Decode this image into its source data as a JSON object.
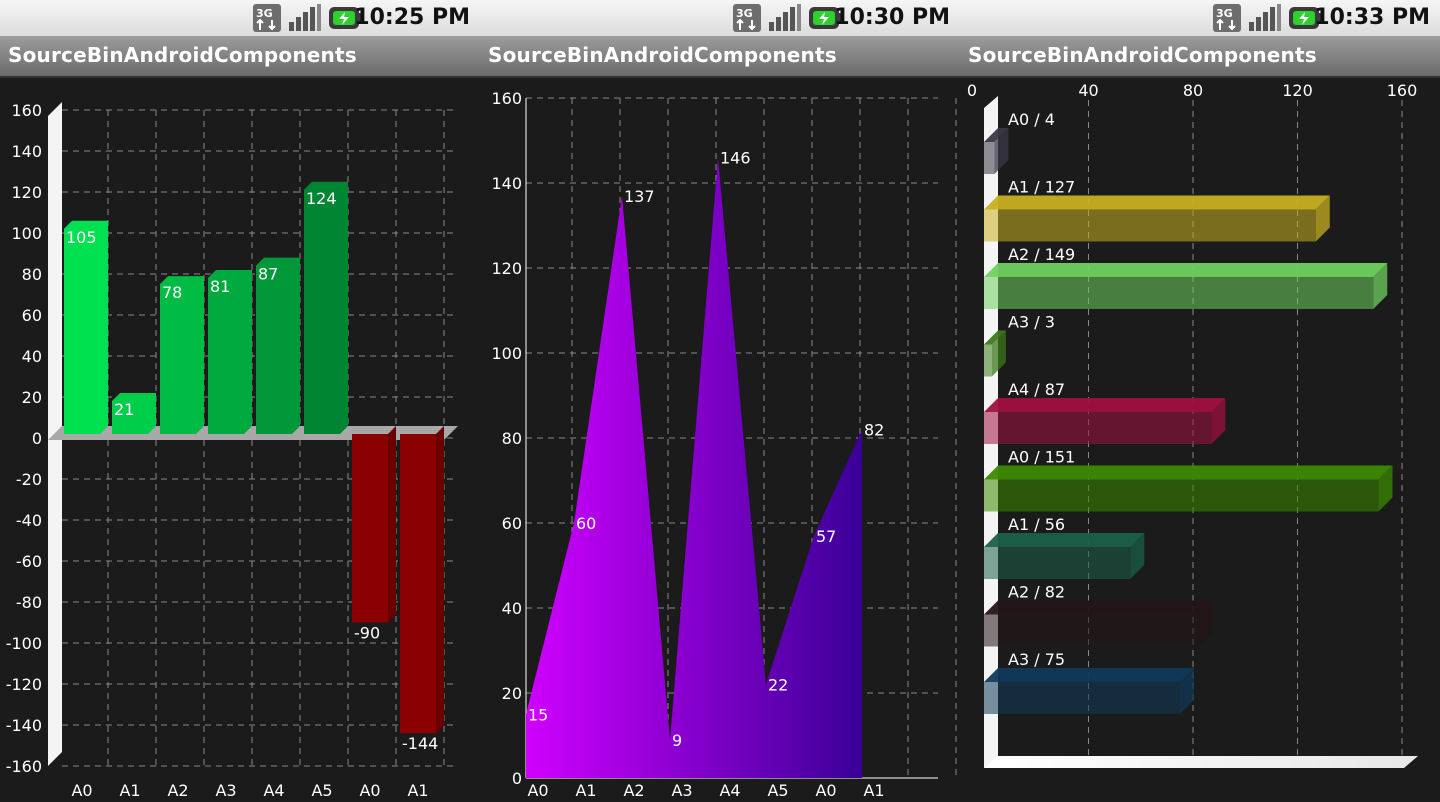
{
  "screens": [
    {
      "time": "10:25 PM",
      "title": "SourceBinAndroidComponents"
    },
    {
      "time": "10:30 PM",
      "title": "SourceBinAndroidComponents"
    },
    {
      "time": "10:33 PM",
      "title": "SourceBinAndroidComponents"
    }
  ],
  "status_icons": [
    "network-3g-icon",
    "signal-strength-icon",
    "battery-charging-icon"
  ],
  "colors": {
    "positive_bar": "#00d050",
    "negative_bar": "#8b0000",
    "area_start": "#d000ff",
    "area_end": "#3a0098"
  },
  "chart_data": [
    {
      "type": "bar",
      "categories": [
        "A0",
        "A1",
        "A2",
        "A3",
        "A4",
        "A5",
        "A0",
        "A1"
      ],
      "values": [
        105,
        21,
        78,
        81,
        87,
        124,
        -90,
        -144
      ],
      "ylim": [
        -160,
        160
      ],
      "yticks": [
        160,
        140,
        120,
        100,
        80,
        60,
        40,
        20,
        0,
        -20,
        -40,
        -60,
        -80,
        -100,
        -120,
        -140,
        -160
      ],
      "grid": true
    },
    {
      "type": "area",
      "categories": [
        "A0",
        "A1",
        "A2",
        "A3",
        "A4",
        "A5",
        "A0",
        "A1"
      ],
      "values": [
        15,
        60,
        137,
        9,
        146,
        22,
        57,
        82
      ],
      "ylim": [
        0,
        160
      ],
      "yticks": [
        0,
        20,
        40,
        60,
        80,
        100,
        120,
        140,
        160
      ],
      "grid": true
    },
    {
      "type": "bar",
      "orientation": "horizontal",
      "categories": [
        "A0",
        "A1",
        "A2",
        "A3",
        "A4",
        "A0",
        "A1",
        "A2",
        "A3"
      ],
      "values": [
        4,
        127,
        149,
        3,
        87,
        151,
        56,
        82,
        75
      ],
      "labels": [
        "A0 / 4",
        "A1 / 127",
        "A2 / 149",
        "A3 / 3",
        "A4 / 87",
        "A0 / 151",
        "A1 / 56",
        "A2 / 82",
        "A3 / 75"
      ],
      "colors": [
        "#3a3848",
        "#c8b020",
        "#70d060",
        "#3c7a1a",
        "#a01040",
        "#3c8a00",
        "#1a6048",
        "#241418",
        "#103a5a"
      ],
      "xlim": [
        0,
        160
      ],
      "xticks": [
        0,
        40,
        80,
        120,
        160
      ],
      "grid": true
    }
  ]
}
